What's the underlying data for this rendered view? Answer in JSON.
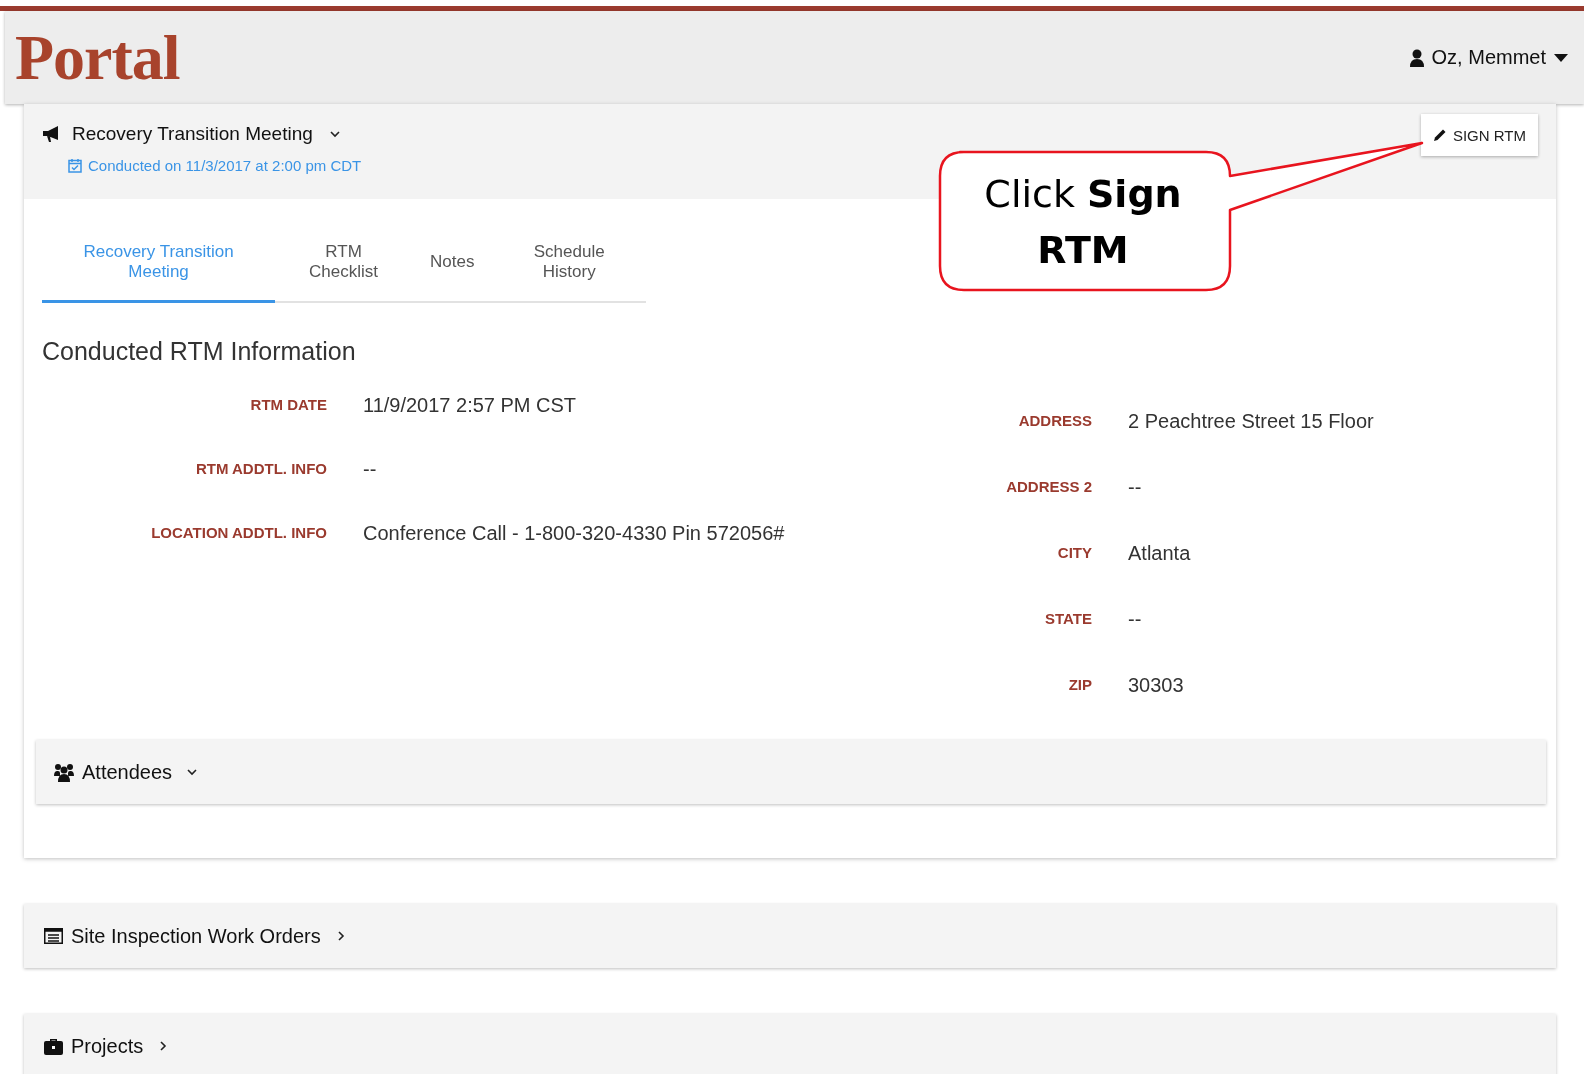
{
  "header": {
    "logo": "Portal",
    "user": "Oz, Memmet"
  },
  "meeting": {
    "title": "Recovery Transition Meeting",
    "expanded": true,
    "conducted": "Conducted on 11/3/2017 at 2:00 pm CDT",
    "sign_button": "SIGN RTM"
  },
  "tabs": [
    {
      "label": "Recovery Transition Meeting",
      "selected": true
    },
    {
      "label": "RTM Checklist",
      "selected": false
    },
    {
      "label": "Notes",
      "selected": false
    },
    {
      "label": "Schedule History",
      "selected": false
    }
  ],
  "section_title": "Conducted RTM Information",
  "left_fields": [
    {
      "label": "RTM DATE",
      "value": "11/9/2017 2:57 PM CST"
    },
    {
      "label": "RTM ADDTL. INFO",
      "value": "--"
    },
    {
      "label": "LOCATION ADDTL. INFO",
      "value": "Conference Call - 1-800-320-4330 Pin 572056#"
    }
  ],
  "right_fields": [
    {
      "label": "ADDRESS",
      "value": "2 Peachtree Street 15 Floor"
    },
    {
      "label": "ADDRESS 2",
      "value": "--"
    },
    {
      "label": "CITY",
      "value": "Atlanta"
    },
    {
      "label": "STATE",
      "value": "--"
    },
    {
      "label": "ZIP",
      "value": "30303"
    }
  ],
  "attendees_panel": {
    "label": "Attendees",
    "expanded": true
  },
  "site_inspection_panel": {
    "label": "Site Inspection Work Orders",
    "expanded": false
  },
  "projects_panel": {
    "label": "Projects",
    "expanded": false
  },
  "callout": {
    "text": "Click **Sign** **RTM**"
  }
}
